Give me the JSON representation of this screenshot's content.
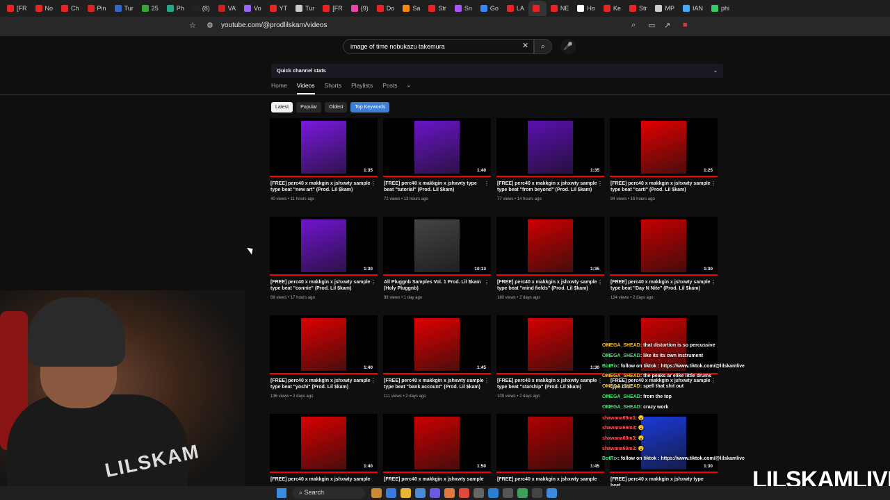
{
  "browser": {
    "tabs": [
      "[FR",
      "No",
      "Ch",
      "Pin",
      "Tur",
      "25",
      "Ph",
      "(8)",
      "VA",
      "Vo",
      "YT",
      "Tur",
      "[FR",
      "(9)",
      "Do",
      "Sa",
      "Str",
      "Sn",
      "Go",
      "LA",
      "",
      "NE",
      "Ho",
      "Ke",
      "Str",
      "MP",
      "IAN",
      "phi"
    ],
    "url": "youtube.com/@prodlilskam/videos"
  },
  "youtube": {
    "search_value": "image of time nobukazu takemura",
    "quick_stats_label": "Quick channel stats",
    "channel_tabs": [
      "Home",
      "Videos",
      "Shorts",
      "Playlists",
      "Posts"
    ],
    "active_tab": "Videos",
    "chips": [
      "Latest",
      "Popular",
      "Oldest",
      "Top Keywords"
    ],
    "videos": [
      {
        "title": "[FREE] perc40 x makkgin x jshxwty sample type beat \"new art\" (Prod. Lil $kam)",
        "meta": "40 views • 11 hours ago",
        "duration": "1:35",
        "color": "#7a18e0"
      },
      {
        "title": "[FREE] perc40 x makkgin x jshxwty type beat \"tutorial\" (Prod. Lil $kam)",
        "meta": "72 views • 13 hours ago",
        "duration": "1:40",
        "color": "#6a14c8"
      },
      {
        "title": "[FREE] perc40 x makkgin x jshxwty sample type beat \"from beyond\" (Prod. Lil $kam)",
        "meta": "77 views • 14 hours ago",
        "duration": "1:35",
        "color": "#5b10b0"
      },
      {
        "title": "[FREE] perc40 x makkgin x jshxwty sample type beat \"carti\" (Prod. Lil $kam)",
        "meta": "84 views • 16 hours ago",
        "duration": "1:25",
        "color": "#e00000"
      },
      {
        "title": "[FREE] perc40 x makkgin x jshxwty sample type beat \"connie\" (Prod. Lil $kam)",
        "meta": "68 views • 17 hours ago",
        "duration": "1:30",
        "color": "#7014d0"
      },
      {
        "title": "All Pluggnb Samples Vol. 1 Prod. Lil $kam (Holy Pluggnb)",
        "meta": "98 views • 1 day ago",
        "duration": "10:13",
        "color": "#444444"
      },
      {
        "title": "[FREE] perc40 x makkgin x jshxwty sample type beat \"mind fields\" (Prod. Lil $kam)",
        "meta": "180 views • 2 days ago",
        "duration": "1:35",
        "color": "#cc0000"
      },
      {
        "title": "[FREE] perc40 x makkgin x jshxwty sample type beat \"Day N Nite\" (Prod. Lil $kam)",
        "meta": "124 views • 2 days ago",
        "duration": "1:30",
        "color": "#c40000"
      },
      {
        "title": "[FREE] perc40 x makkgin x jshxwty sample type beat \"yoshi\" (Prod. Lil $kam)",
        "meta": "136 views • 2 days ago",
        "duration": "1:40",
        "color": "#dd0000"
      },
      {
        "title": "[FREE] perc40 x makkgin x jshxwty sample type beat \"bank account\" (Prod. Lil $kam)",
        "meta": "111 views • 2 days ago",
        "duration": "1:45",
        "color": "#e00000"
      },
      {
        "title": "[FREE] perc40 x makkgin x jshxwty sample type beat \"starship\" (Prod. Lil $kam)",
        "meta": "109 views • 2 days ago",
        "duration": "1:30",
        "color": "#d40000"
      },
      {
        "title": "[FREE] perc40 x makkgin x jshxwty sample type beat",
        "meta": "",
        "duration": "",
        "color": "#cc0000"
      },
      {
        "title": "[FREE] perc40 x makkgin x jshxwty sample",
        "meta": "",
        "duration": "1:40",
        "color": "#d80000"
      },
      {
        "title": "[FREE] perc40 x makkgin x jshxwty sample",
        "meta": "",
        "duration": "1:50",
        "color": "#cc0000"
      },
      {
        "title": "[FREE] perc40 x makkgin x jshxwty sample",
        "meta": "",
        "duration": "1:45",
        "color": "#b00000"
      },
      {
        "title": "[FREE] perc40 x makkgin x jshxwty type beat",
        "meta": "",
        "duration": "1:30",
        "color": "#1a3ad8"
      }
    ]
  },
  "chat": [
    {
      "name": "OMEGA_SHEAD",
      "msg": ": that distortion is so percussive",
      "color": "y"
    },
    {
      "name": "OMEGA_SHEAD",
      "msg": ": like its its own instrument",
      "color": "g"
    },
    {
      "name": "BotRix",
      "msg": ": follow on tiktok : https://www.tiktok.com/@lilskamlive",
      "color": "g"
    },
    {
      "name": "OMEGA_SHEAD",
      "msg": ": the peaks ar elike little drums",
      "color": "y"
    },
    {
      "name": "OMEGA_SHEAD",
      "msg": ": spell that shit out",
      "color": "y"
    },
    {
      "name": "OMEGA_SHEAD",
      "msg": ": from the top",
      "color": "g"
    },
    {
      "name": "OMEGA_SHEAD",
      "msg": ": crazy work",
      "color": "g"
    },
    {
      "name": "shawana69m3",
      "msg": ": 😮",
      "color": "r"
    },
    {
      "name": "shawana69m3",
      "msg": ": 😮",
      "color": "r"
    },
    {
      "name": "shawana69m3",
      "msg": ": 😮",
      "color": "r"
    },
    {
      "name": "shawana69m3",
      "msg": ": 😮",
      "color": "r"
    },
    {
      "name": "BotRix",
      "msg": ": follow on tiktok : https://www.tiktok.com/@lilskamlive",
      "color": "g"
    }
  ],
  "overlay": {
    "brand": "LILSKAMLIVE",
    "webcam_text": "LILSKAM"
  },
  "taskbar": {
    "search_label": "Search"
  }
}
